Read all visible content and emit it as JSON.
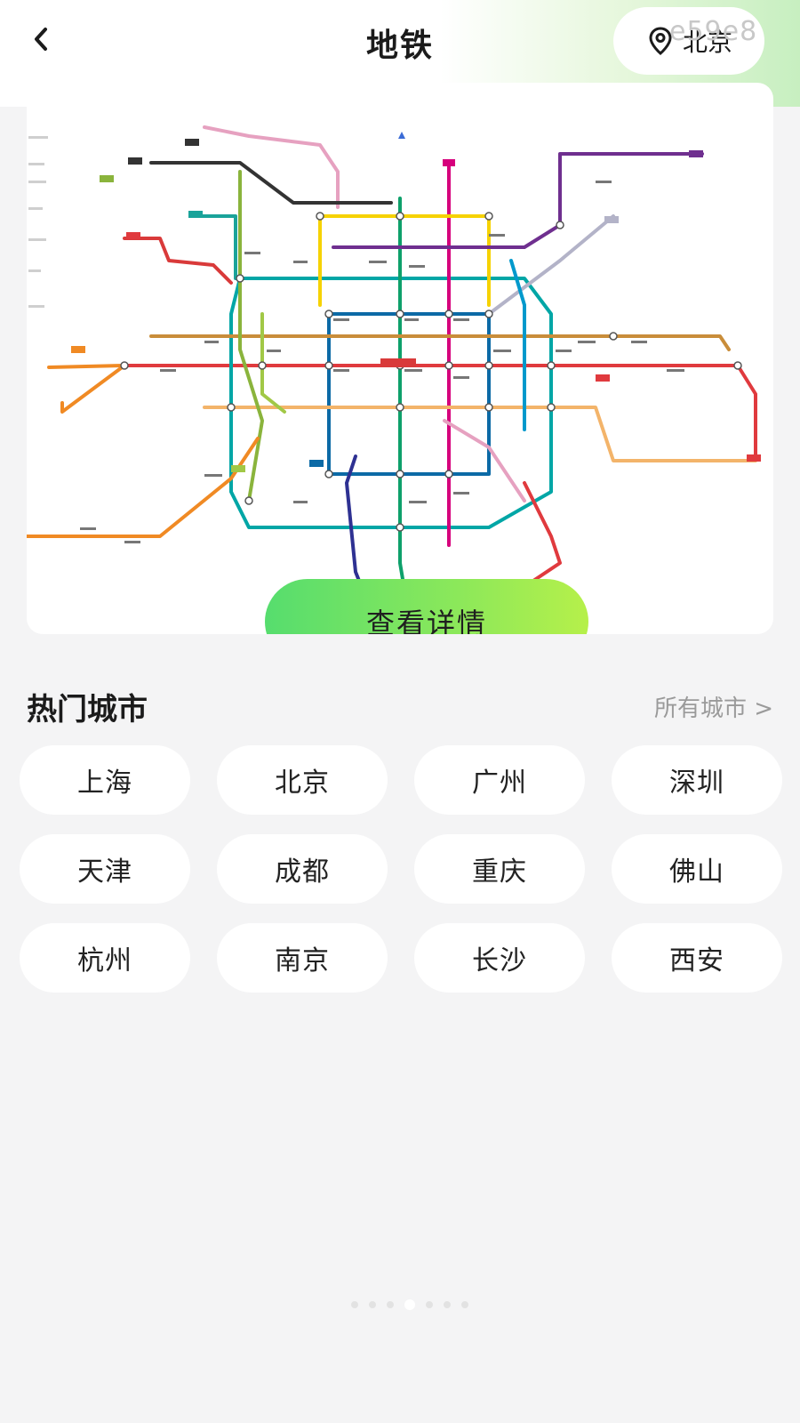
{
  "header": {
    "title": "地铁",
    "city": "北京",
    "watermark": "e59e8",
    "back_icon": "chevron-left-icon",
    "location_icon": "location-pin-icon"
  },
  "map": {
    "image_desc": "beijing-subway-map",
    "detail_button_label": "查看详情",
    "line_colors": [
      "#e03a3e",
      "#6f2f8f",
      "#00a6a6",
      "#f6d200",
      "#a1c846",
      "#e6a1c0",
      "#0c6aa6",
      "#f08a24",
      "#2e3192",
      "#d6007c",
      "#0099cc",
      "#8b5a2b",
      "#c0c0c0",
      "#333333",
      "#5ba135"
    ]
  },
  "hot_cities": {
    "title": "热门城市",
    "all_link": "所有城市 >",
    "cities": [
      "上海",
      "北京",
      "广州",
      "深圳",
      "天津",
      "成都",
      "重庆",
      "佛山",
      "杭州",
      "南京",
      "长沙",
      "西安"
    ]
  },
  "pagination": {
    "count": 7,
    "active": 3
  }
}
